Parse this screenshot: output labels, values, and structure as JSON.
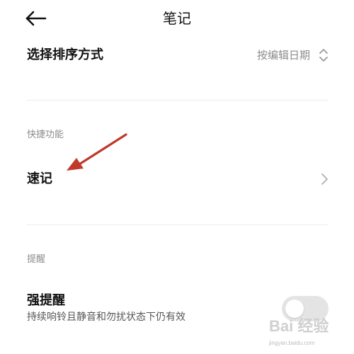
{
  "header": {
    "title": "笔记",
    "back_icon": "arrow-left-icon"
  },
  "sort": {
    "label": "选择排序方式",
    "value": "按编辑日期",
    "icon": "chevron-up-down-icon"
  },
  "shortcuts": {
    "section_title": "快捷功能",
    "quick_note_label": "速记",
    "icon": "chevron-right-icon"
  },
  "reminders": {
    "section_title": "提醒",
    "strong_reminder_label": "强提醒",
    "strong_reminder_desc": "持续响铃且静音和勿扰状态下仍有效",
    "toggle_on": false
  },
  "annotation": {
    "arrow_color": "#c0392b",
    "icon": "red-arrow-annotation"
  },
  "watermark": {
    "main": "Bai 经验",
    "sub": "jingyan.baidu.com"
  },
  "colors": {
    "background": "#ffffff",
    "text": "#111111",
    "secondary_text": "#8c8c8c",
    "divider": "#ececec",
    "toggle_off": "#e4e4e4"
  }
}
